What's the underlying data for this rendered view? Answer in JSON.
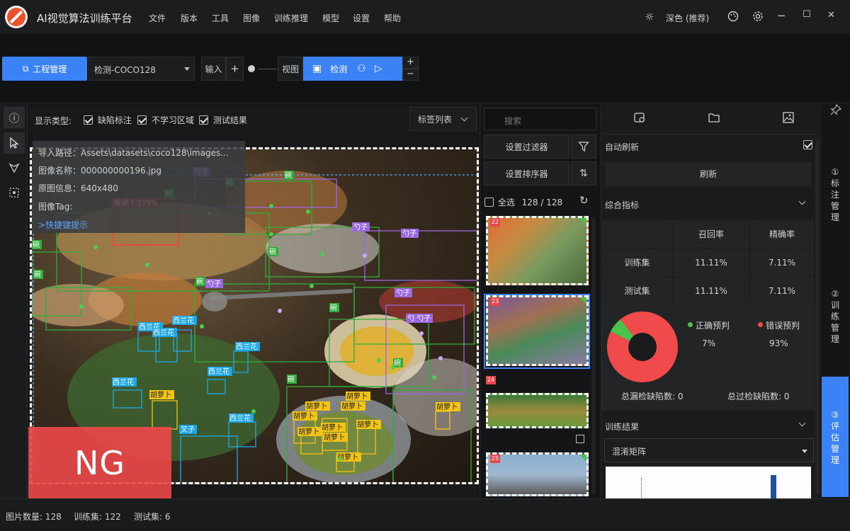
{
  "app": {
    "title": "AI视觉算法训练平台"
  },
  "menu": [
    "文件",
    "版本",
    "工具",
    "图像",
    "训练推理",
    "模型",
    "设置",
    "帮助"
  ],
  "window": {
    "theme_label": "深色 (推荐)",
    "min": "−",
    "max": "☐",
    "close": "✕"
  },
  "toolbar": {
    "project_button": "工程管理",
    "project_select": "检测-COCO128",
    "input_label": "输入",
    "plus": "+",
    "view_label": "视图",
    "detect_label": "检测",
    "stack_plus": "+",
    "stack_minus": "−"
  },
  "display": {
    "label": "显示类型:",
    "options": [
      {
        "label": "缺陷标注",
        "checked": true
      },
      {
        "label": "不学习区域",
        "checked": true
      },
      {
        "label": "测试结果",
        "checked": true
      }
    ],
    "tag_list": "标签列表"
  },
  "image_info": {
    "path": "导入路径：Assets\\datasets\\coco128\\images...",
    "name": "图像名称：000000000196.jpg",
    "original": "原图信息：640x480",
    "tag": "图像Tag:",
    "shortcut": ">快捷键提示"
  },
  "result_badge": "NG",
  "box_labels": [
    {
      "text": "碗",
      "color": "#2fae3a"
    },
    {
      "text": "勺子",
      "color": "#9a68e0"
    },
    {
      "text": "西兰花",
      "color": "#1ea7e6"
    },
    {
      "text": "胡萝卜",
      "color": "#f4c414"
    },
    {
      "text": "叉子",
      "color": "#1ea7e6"
    },
    {
      "text": "勺 勺子",
      "color": "#9a68e0"
    },
    {
      "text": "餐桌 1.139%",
      "color": "#e84848"
    }
  ],
  "thumbs": {
    "search_placeholder": "搜索",
    "filter_button": "设置过滤器",
    "sort_button": "设置排序器",
    "select_all": "全选",
    "count": "128 / 128",
    "items": [
      {
        "num": "22"
      },
      {
        "num": "23"
      },
      {
        "num": "24"
      },
      {
        "num": "25"
      }
    ]
  },
  "right_panel": {
    "auto_refresh": "自动刷新",
    "refresh": "刷新",
    "metrics_title": "综合指标",
    "headers": [
      "召回率",
      "精确率"
    ],
    "rows": [
      {
        "name": "训练集",
        "recall": "11.11%",
        "precision": "7.11%"
      },
      {
        "name": "测试集",
        "recall": "11.11%",
        "precision": "7.11%"
      }
    ],
    "pie": {
      "correct_label": "正确预判",
      "correct_value": "7%",
      "wrong_label": "错误预判",
      "wrong_value": "93%",
      "correct_fraction": 0.07,
      "correct_color": "#4bc24b",
      "wrong_color": "#f04a4a"
    },
    "missed": "总漏检缺陷数:  0",
    "over": "总过检缺陷数:  0",
    "results_title": "训练结果",
    "confusion_select": "混淆矩阵"
  },
  "vtabs": [
    {
      "label": "①标注管理"
    },
    {
      "label": "②训练管理"
    },
    {
      "label": "③评估管理"
    }
  ],
  "status": {
    "images": "图片数量:  128",
    "train": "训练集:  122",
    "test": "测试集:  6"
  },
  "colors": {
    "accent": "#3a82f6",
    "bg": "#111213",
    "panel": "#1a1b1d"
  }
}
